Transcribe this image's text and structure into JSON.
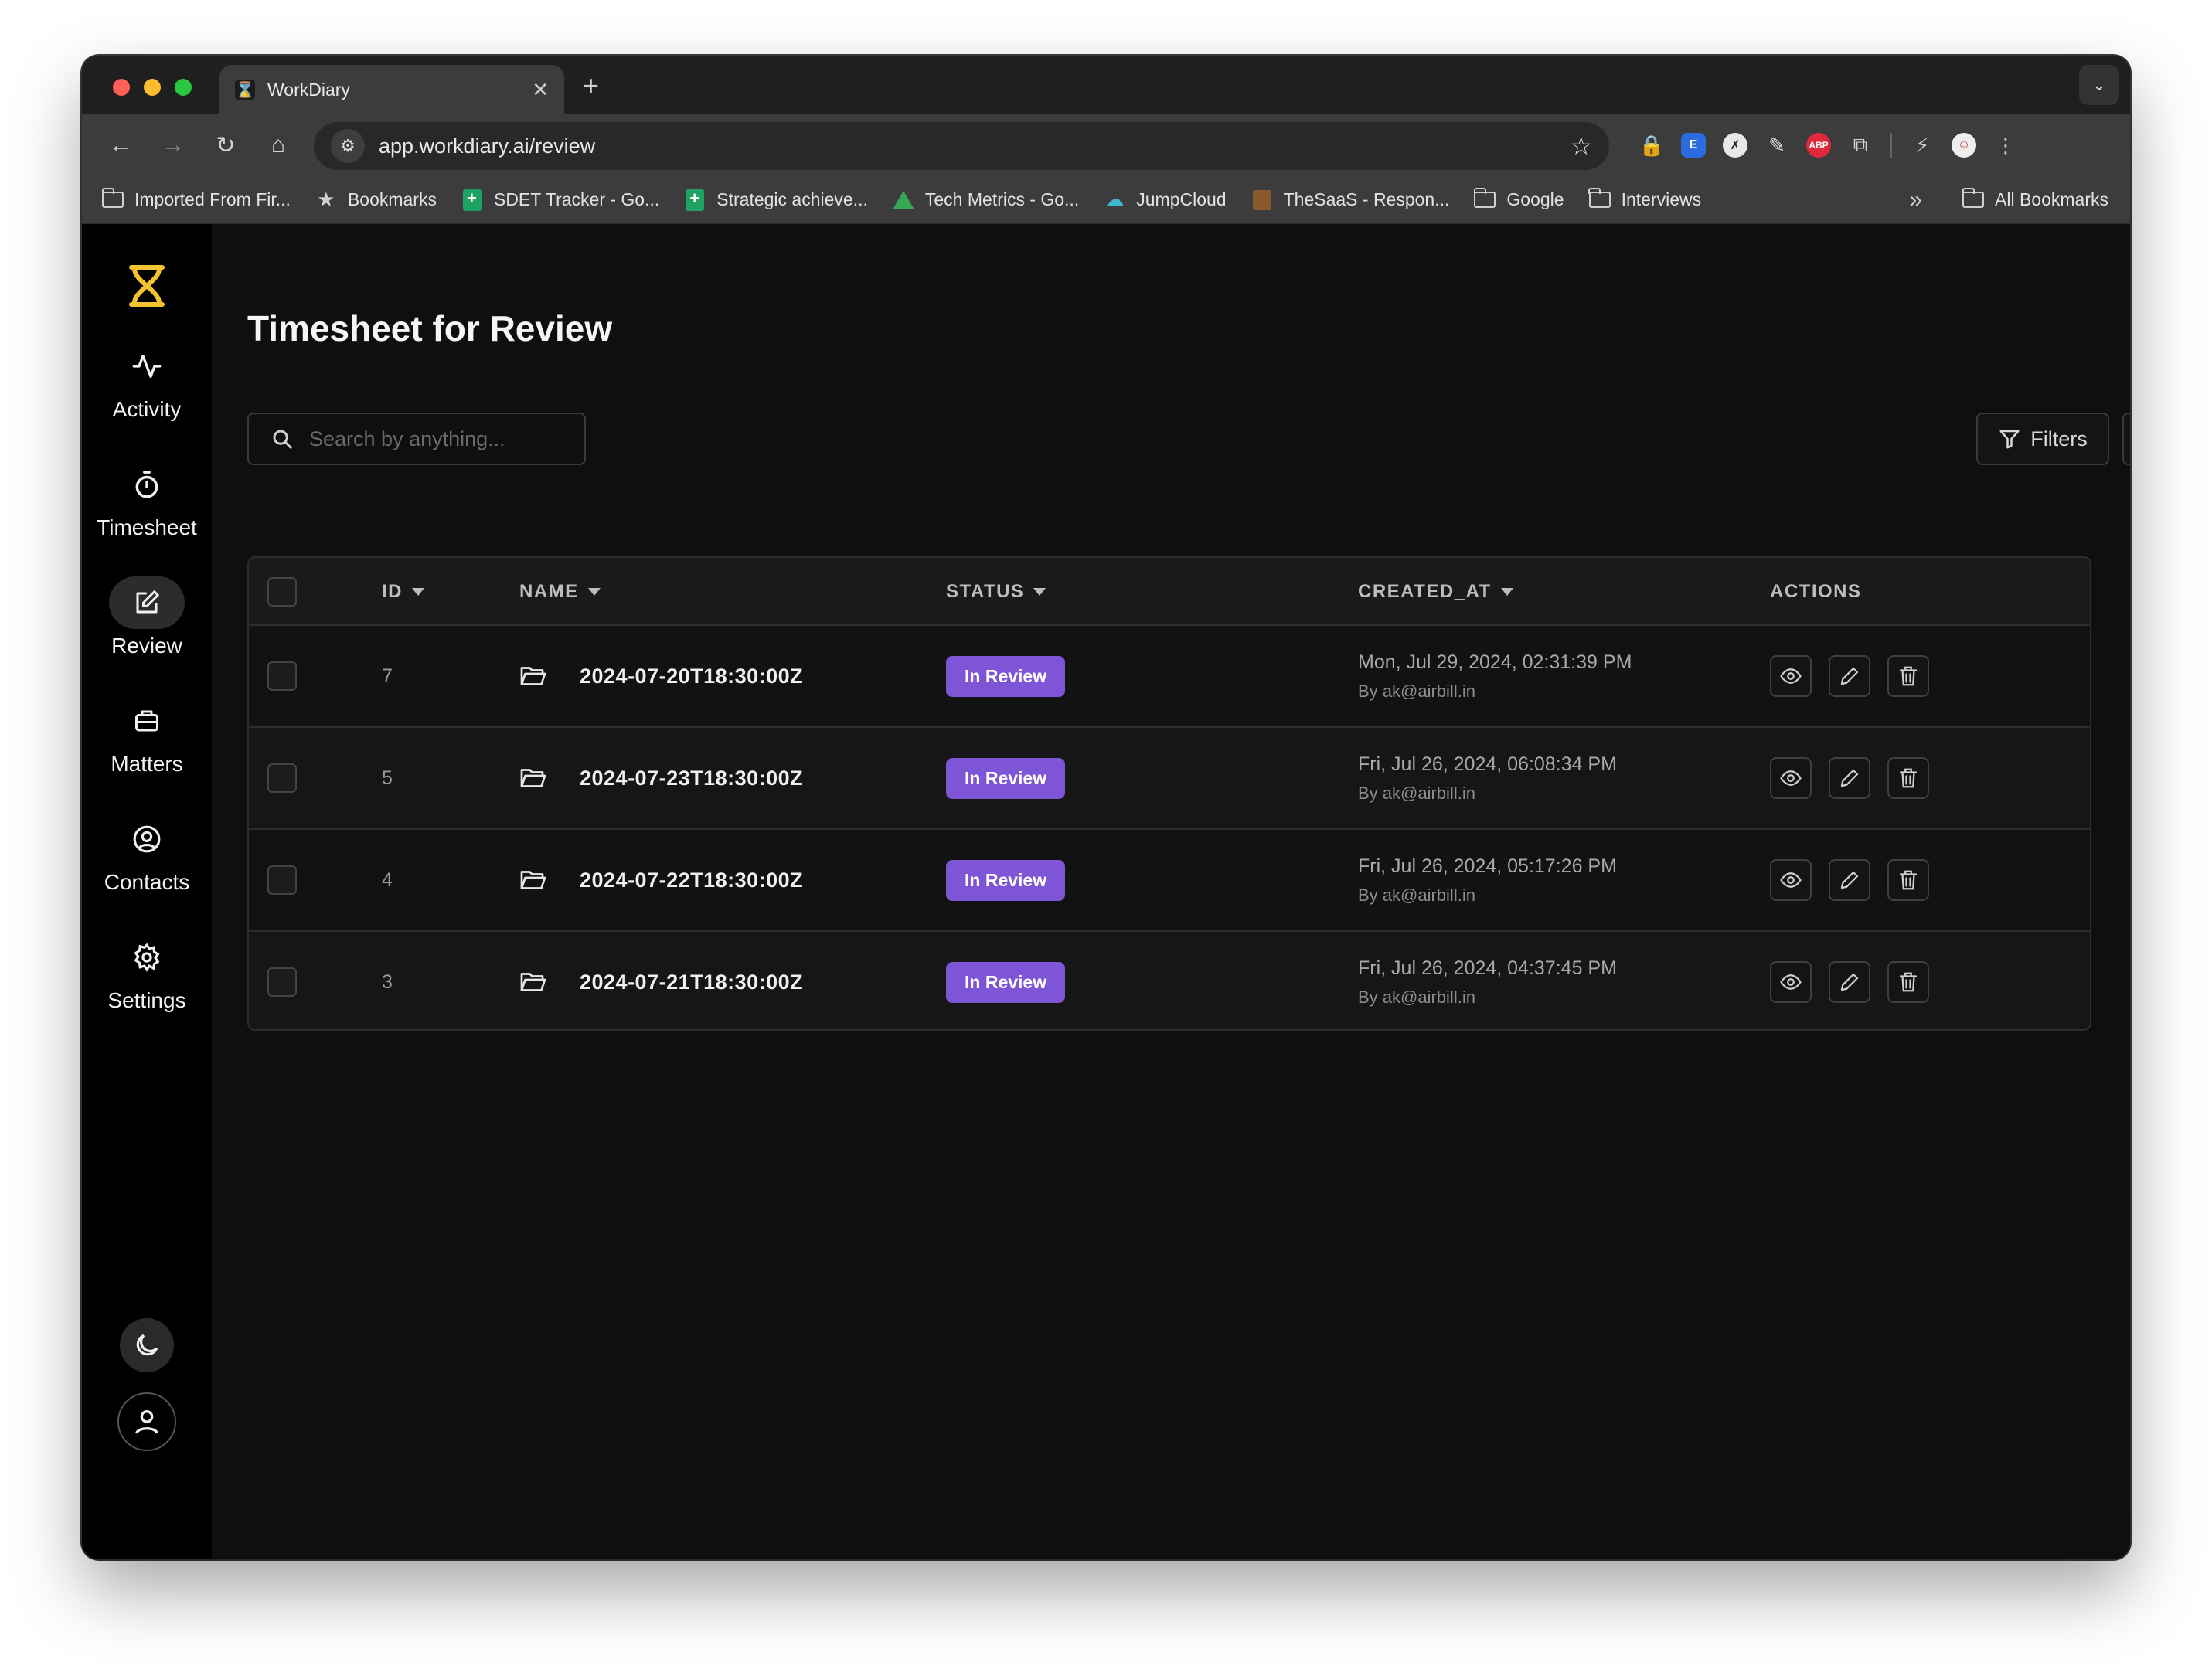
{
  "browser": {
    "tab_title": "WorkDiary",
    "url": "app.workdiary.ai/review",
    "bookmarks": [
      {
        "label": "Imported From Fir...",
        "icon": "folder-icon"
      },
      {
        "label": "Bookmarks",
        "icon": "star-icon"
      },
      {
        "label": "SDET Tracker - Go...",
        "icon": "sheets-icon"
      },
      {
        "label": "Strategic achieve...",
        "icon": "sheets-icon"
      },
      {
        "label": "Tech Metrics - Go...",
        "icon": "drive-icon"
      },
      {
        "label": "JumpCloud",
        "icon": "jumpcloud-icon"
      },
      {
        "label": "TheSaaS - Respon...",
        "icon": "thesaas-icon"
      },
      {
        "label": "Google",
        "icon": "folder-icon"
      },
      {
        "label": "Interviews",
        "icon": "folder-icon"
      }
    ],
    "all_bookmarks": "All Bookmarks",
    "ext_abp": "ABP",
    "ext_e": "E"
  },
  "sidebar": {
    "items": [
      {
        "label": "Activity",
        "icon": "activity-icon"
      },
      {
        "label": "Timesheet",
        "icon": "stopwatch-icon"
      },
      {
        "label": "Review",
        "icon": "edit-icon"
      },
      {
        "label": "Matters",
        "icon": "briefcase-icon"
      },
      {
        "label": "Contacts",
        "icon": "user-circle-icon"
      },
      {
        "label": "Settings",
        "icon": "gear-icon"
      }
    ],
    "active": "Review"
  },
  "main": {
    "title": "Timesheet for Review",
    "search_placeholder": "Search by anything...",
    "filters_label": "Filters",
    "columns": {
      "id": "ID",
      "name": "NAME",
      "status": "STATUS",
      "created_at": "CREATED_AT",
      "actions": "ACTIONS"
    },
    "rows": [
      {
        "id": "7",
        "name": "2024-07-20T18:30:00Z",
        "status": "In Review",
        "created": "Mon, Jul 29, 2024, 02:31:39 PM",
        "by": "By ak@airbill.in"
      },
      {
        "id": "5",
        "name": "2024-07-23T18:30:00Z",
        "status": "In Review",
        "created": "Fri, Jul 26, 2024, 06:08:34 PM",
        "by": "By ak@airbill.in"
      },
      {
        "id": "4",
        "name": "2024-07-22T18:30:00Z",
        "status": "In Review",
        "created": "Fri, Jul 26, 2024, 05:17:26 PM",
        "by": "By ak@airbill.in"
      },
      {
        "id": "3",
        "name": "2024-07-21T18:30:00Z",
        "status": "In Review",
        "created": "Fri, Jul 26, 2024, 04:37:45 PM",
        "by": "By ak@airbill.in"
      }
    ]
  },
  "colors": {
    "accent": "#7d55d6",
    "logo": "#f4c430",
    "background": "#0f0f0f"
  }
}
